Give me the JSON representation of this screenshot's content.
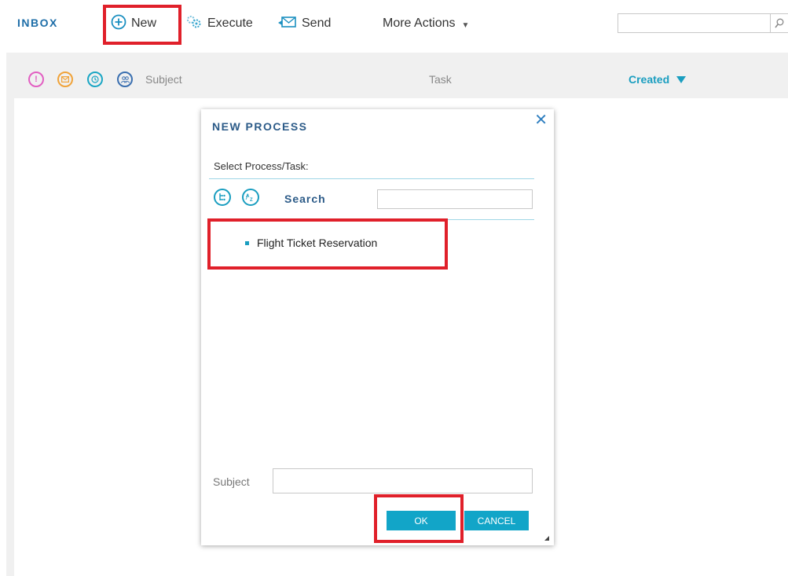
{
  "toolbar": {
    "title": "INBOX",
    "new_label": "New",
    "execute_label": "Execute",
    "send_label": "Send",
    "more_actions_label": "More Actions",
    "search_value": ""
  },
  "list_header": {
    "subject": "Subject",
    "task": "Task",
    "created": "Created",
    "icons": [
      "priority-icon",
      "message-icon",
      "clock-icon",
      "group-icon"
    ]
  },
  "dialog": {
    "title": "NEW PROCESS",
    "close_glyph": "✕",
    "select_label": "Select Process/Task:",
    "search_label": "Search",
    "search_value": "",
    "tree_items": [
      "Flight Ticket Reservation"
    ],
    "subject_label": "Subject",
    "subject_value": "",
    "ok_label": "OK",
    "cancel_label": "CANCEL"
  },
  "colors": {
    "accent": "#1a9ec0",
    "title_blue": "#2c5b88",
    "highlight_red": "#e0202a",
    "button_bg": "#12a5c8"
  }
}
